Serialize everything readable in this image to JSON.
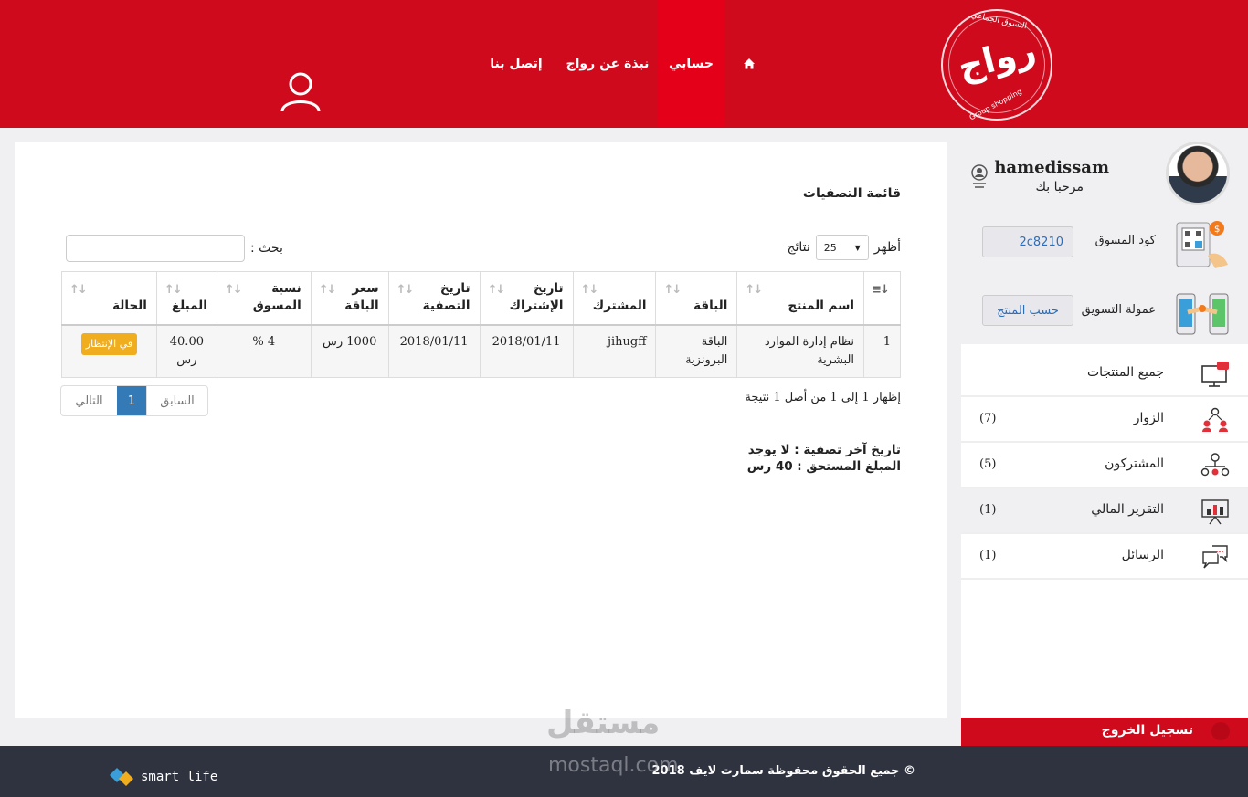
{
  "header": {
    "logo_text": "رواج",
    "logo_top": "التسوق الجماعي",
    "logo_bottom": "Group shopping",
    "nav": {
      "home_icon": "home-icon",
      "account": "حسابي",
      "about": "نبذة عن رواج",
      "contact": "إتصل بنا"
    },
    "user_icon": "user-icon"
  },
  "main": {
    "title": "قائمة التصفيات",
    "length": {
      "show": "أظهر",
      "value": "25",
      "results": "نتائج"
    },
    "search": {
      "label": "بحث :",
      "value": ""
    },
    "columns": [
      "اسم المنتج",
      "الباقة",
      "المشترك",
      "تاريخ الإشتراك",
      "تاريخ التصفية",
      "سعر الباقة",
      "نسبة المسوق",
      "المبلغ",
      "الحالة"
    ],
    "rows": [
      {
        "index": "1",
        "product": "نظام إدارة الموارد البشرية",
        "package": "الباقة البرونزية",
        "subscriber": "jihugff",
        "subscription_date": "2018/01/11",
        "settlement_date": "2018/01/11",
        "package_price": "1000 رس",
        "marketer_rate": "4 %",
        "amount": "40.00 رس",
        "status": "في الإنتظار"
      }
    ],
    "info": "إظهار 1 إلى 1 من أصل 1 نتيجة",
    "pager": {
      "prev": "السابق",
      "current": "1",
      "next": "التالي"
    },
    "summary": {
      "last_settlement": "تاريخ آخر تصفية : لا يوجد",
      "amount_due": "المبلغ المستحق : 40 رس"
    }
  },
  "sidebar": {
    "username": "hamedissam",
    "welcome": "مرحبا بك",
    "code_label": "كود المسوق",
    "code_value": "2c8210",
    "commission_label": "عمولة التسويق",
    "commission_value": "حسب المنتج",
    "menu": [
      {
        "label": "جميع المنتجات",
        "count": "",
        "icon": "monitor-icon"
      },
      {
        "label": "الزوار",
        "count": "(7)",
        "icon": "visitors-icon"
      },
      {
        "label": "المشتركون",
        "count": "(5)",
        "icon": "network-icon"
      },
      {
        "label": "التقرير المالي",
        "count": "(1)",
        "icon": "chart-board-icon"
      },
      {
        "label": "الرسائل",
        "count": "(1)",
        "icon": "chat-icon"
      }
    ],
    "logout": "تسجيل الخروج"
  },
  "footer": {
    "copyright": "© جميع الحقوق محفوظة سمارت لايف 2018",
    "brand": "smart life"
  },
  "watermark": {
    "main": "مستقل",
    "sub": "mostaql.com"
  },
  "colors": {
    "primary_red": "#cf0a1d",
    "active_red": "#e5001a",
    "badge": "#f0ad1e",
    "link_blue": "#337ab7",
    "footer": "#2f3340"
  }
}
